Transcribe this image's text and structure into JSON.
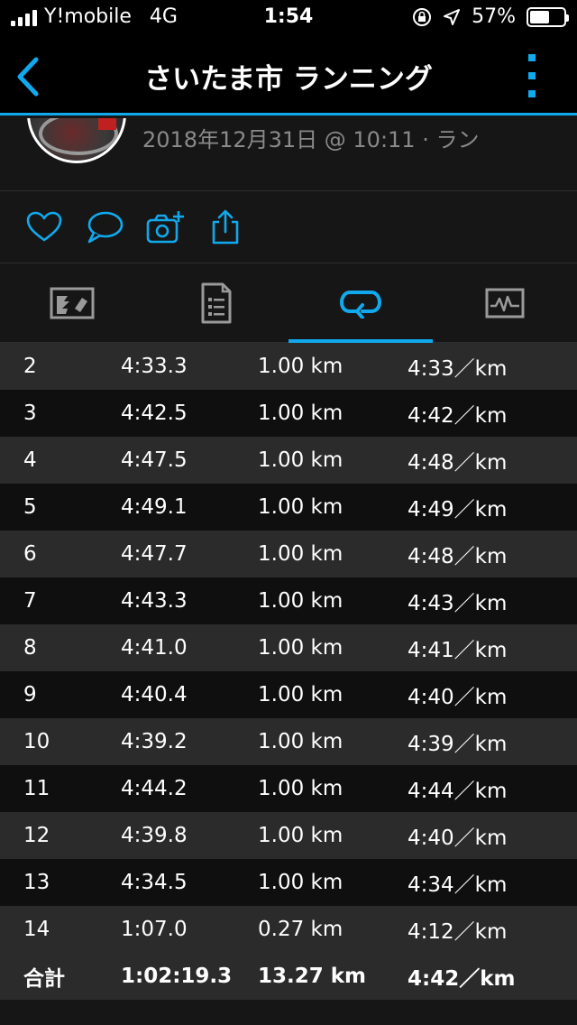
{
  "status": {
    "carrier": "Y!mobile",
    "network": "4G",
    "time": "1:54",
    "battery_percent": "57%",
    "battery_level": 0.57
  },
  "nav": {
    "title": "さいたま市 ランニング"
  },
  "header": {
    "meta": "2018年12月31日 @ 10:11 · ラン"
  },
  "tabs": [
    {
      "icon": "map-icon",
      "active": false
    },
    {
      "icon": "details-icon",
      "active": false
    },
    {
      "icon": "laps-icon",
      "active": true
    },
    {
      "icon": "chart-icon",
      "active": false
    }
  ],
  "laps": [
    {
      "lap": "2",
      "time": "4:33.3",
      "distance": "1.00 km",
      "pace": "4:33／km"
    },
    {
      "lap": "3",
      "time": "4:42.5",
      "distance": "1.00 km",
      "pace": "4:42／km"
    },
    {
      "lap": "4",
      "time": "4:47.5",
      "distance": "1.00 km",
      "pace": "4:48／km"
    },
    {
      "lap": "5",
      "time": "4:49.1",
      "distance": "1.00 km",
      "pace": "4:49／km"
    },
    {
      "lap": "6",
      "time": "4:47.7",
      "distance": "1.00 km",
      "pace": "4:48／km"
    },
    {
      "lap": "7",
      "time": "4:43.3",
      "distance": "1.00 km",
      "pace": "4:43／km"
    },
    {
      "lap": "8",
      "time": "4:41.0",
      "distance": "1.00 km",
      "pace": "4:41／km"
    },
    {
      "lap": "9",
      "time": "4:40.4",
      "distance": "1.00 km",
      "pace": "4:40／km"
    },
    {
      "lap": "10",
      "time": "4:39.2",
      "distance": "1.00 km",
      "pace": "4:39／km"
    },
    {
      "lap": "11",
      "time": "4:44.2",
      "distance": "1.00 km",
      "pace": "4:44／km"
    },
    {
      "lap": "12",
      "time": "4:39.8",
      "distance": "1.00 km",
      "pace": "4:40／km"
    },
    {
      "lap": "13",
      "time": "4:34.5",
      "distance": "1.00 km",
      "pace": "4:34／km"
    },
    {
      "lap": "14",
      "time": "1:07.0",
      "distance": "0.27 km",
      "pace": "4:12／km"
    }
  ],
  "total": {
    "label": "合計",
    "time": "1:02:19.3",
    "distance": "13.27 km",
    "pace": "4:42／km"
  },
  "colors": {
    "accent": "#11a9ed",
    "background": "#161616",
    "row_alt": "#2b2b2b"
  }
}
